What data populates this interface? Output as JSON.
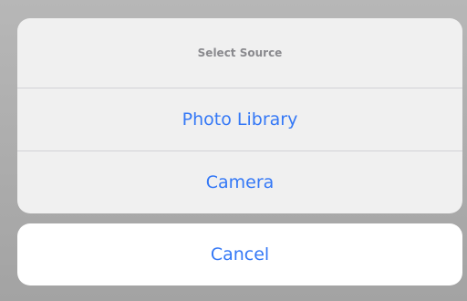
{
  "action_sheet": {
    "title": "Select Source",
    "actions": [
      {
        "label": "Photo Library"
      },
      {
        "label": "Camera"
      }
    ],
    "cancel_label": "Cancel",
    "accent_color": "#3478f6"
  }
}
